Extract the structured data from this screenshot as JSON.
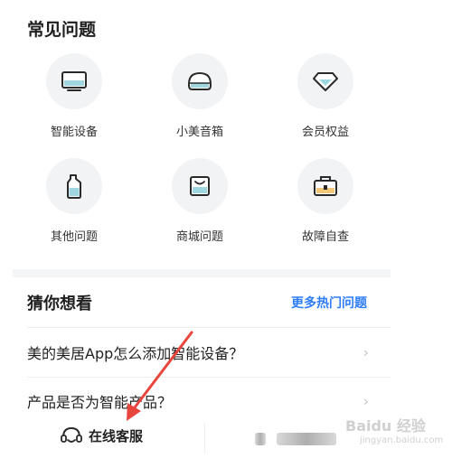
{
  "faq": {
    "title": "常见问题",
    "items": [
      {
        "label": "智能设备",
        "icon": "tv-device-icon"
      },
      {
        "label": "小美音箱",
        "icon": "smart-speaker-icon"
      },
      {
        "label": "会员权益",
        "icon": "diamond-icon"
      },
      {
        "label": "其他问题",
        "icon": "bottle-icon"
      },
      {
        "label": "商城问题",
        "icon": "shopping-bag-icon"
      },
      {
        "label": "故障自查",
        "icon": "toolbox-icon"
      }
    ]
  },
  "guess": {
    "title": "猜你想看",
    "more_label": "更多热门问题",
    "rows": [
      {
        "text": "美的美居App怎么添加智能设备？"
      },
      {
        "text": "产品是否为智能产品？"
      }
    ]
  },
  "bottom": {
    "service_label": "在线客服",
    "service_icon": "headset-icon"
  },
  "watermark": {
    "brand": "Baidu 经验",
    "sub": "jingyan.baidu.com"
  },
  "colors": {
    "accent": "#2f7df6",
    "icon_teal": "#9fd6df",
    "arrow": "#e8453c"
  }
}
